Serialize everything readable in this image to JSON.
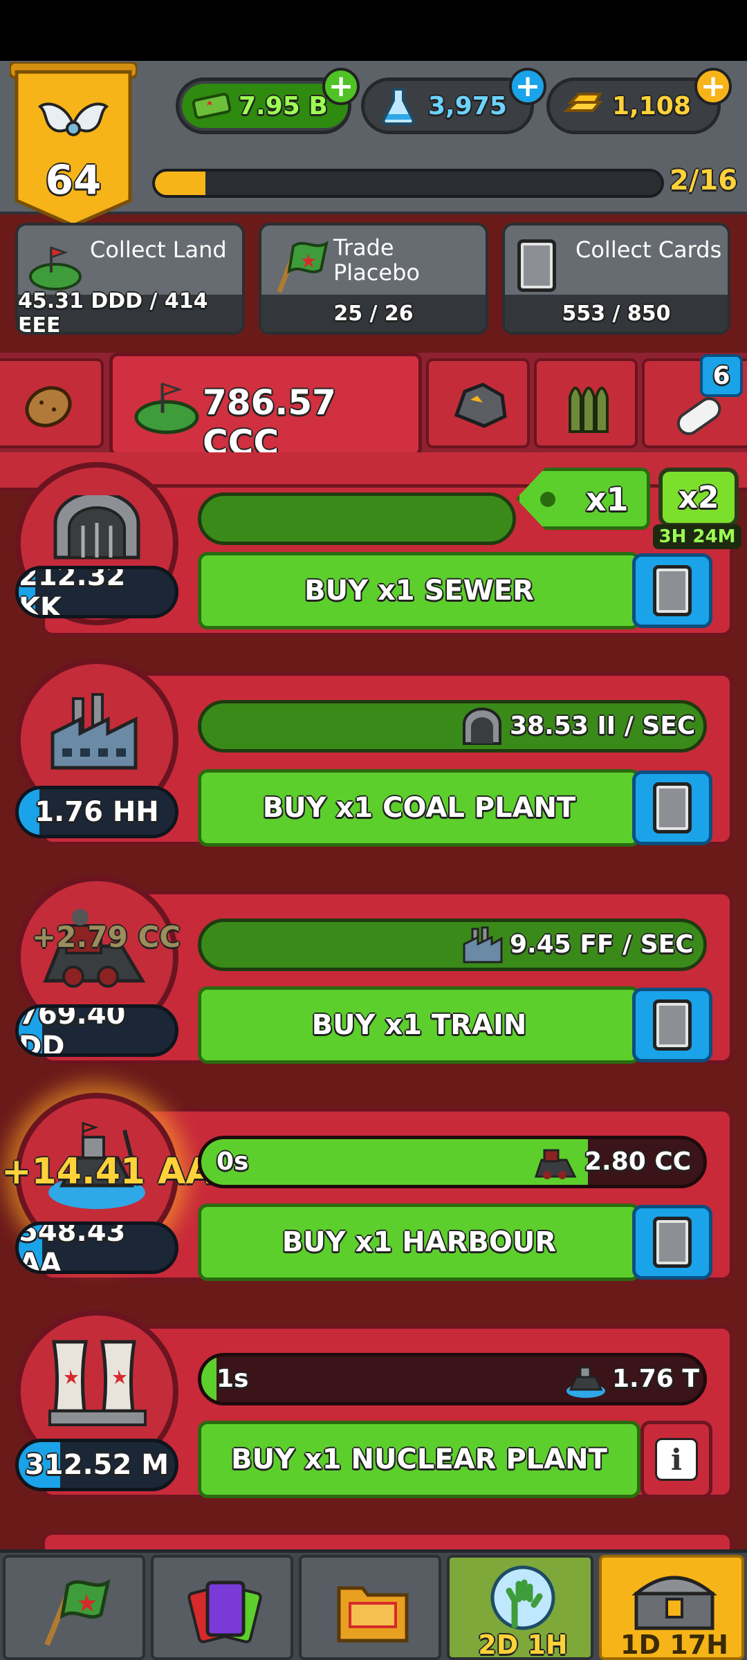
{
  "level": {
    "number": "64",
    "xp_progress": "2/16",
    "xp_fill_fraction": 0.1
  },
  "resources": {
    "money": {
      "value": "7.95 B",
      "icon": "money-icon"
    },
    "science": {
      "value": "3,975",
      "icon": "flask-icon"
    },
    "gold": {
      "value": "1,108",
      "icon": "gold-bars-icon"
    }
  },
  "quests": [
    {
      "title": "Collect Land",
      "progress": "45.31 DDD / 414 EEE",
      "fill_fraction": 0.0
    },
    {
      "title": "Trade Placebo",
      "progress": "25 / 26",
      "fill_fraction": 0.96
    },
    {
      "title": "Collect Cards",
      "progress": "553 / 850",
      "fill_fraction": 0.65
    }
  ],
  "tabs": {
    "active_amount": "786.57 CCC",
    "notification_badge": "6"
  },
  "multiplier": {
    "label": "x1",
    "boost_label": "x2",
    "boost_timer": "3H 24M"
  },
  "buildings": [
    {
      "name": "sewer",
      "price": "212.32 KK",
      "buy_label": "BUY x1 SEWER",
      "price_fill_fraction": 0.1
    },
    {
      "name": "coal-plant",
      "price": "1.76 HH",
      "rate": "38.53 II / SEC",
      "buy_label": "BUY x1 COAL PLANT",
      "price_fill_fraction": 0.12
    },
    {
      "name": "train",
      "price": "769.40 DD",
      "rate": "9.45 FF / SEC",
      "floating_gain": "+2.79 CC",
      "buy_label": "BUY x1 TRAIN",
      "price_fill_fraction": 0.15
    },
    {
      "name": "harbour",
      "price": "548.43 AA",
      "timer": "0s",
      "output": "2.80 CC",
      "floating_gain": "+14.41 AA",
      "buy_label": "BUY x1 HARBOUR",
      "price_fill_fraction": 0.15,
      "progress_fill_fraction": 0.77
    },
    {
      "name": "nuclear-plant",
      "price": "312.52 M",
      "timer": "1s",
      "output": "1.76 T",
      "buy_label": "BUY x1 NUCLEAR PLANT",
      "price_fill_fraction": 0.25,
      "progress_fill_fraction": 0.03
    }
  ],
  "bottom_nav": {
    "zombie_timer": "2D 1H",
    "chest_timer": "1D 17H"
  },
  "colors": {
    "accent_green": "#5ccf2c",
    "accent_red": "#c82a3a",
    "accent_blue": "#1aa3e8",
    "gold": "#f6b418"
  }
}
